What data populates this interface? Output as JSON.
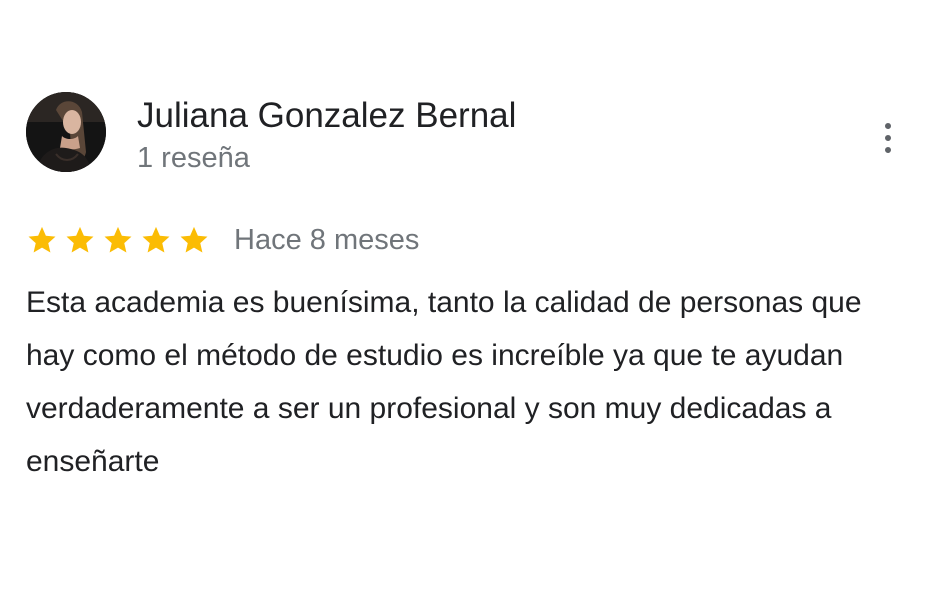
{
  "reviewer": {
    "name": "Juliana Gonzalez Bernal",
    "review_count": "1 reseña",
    "avatar_icon": "profile-photo"
  },
  "menu": {
    "icon": "more-vertical-icon"
  },
  "rating": {
    "stars": 5,
    "max_stars": 5,
    "star_color": "#fbbc04",
    "date": "Hace 8 meses"
  },
  "review": {
    "text": "Esta academia es buenísima, tanto la calidad de personas que hay como el método de estudio es increíble ya que te ayudan verdaderamente a ser un profesional y son muy dedicadas a enseñarte"
  },
  "colors": {
    "primary_text": "#202124",
    "secondary_text": "#70757a",
    "icon": "#5f6368"
  }
}
